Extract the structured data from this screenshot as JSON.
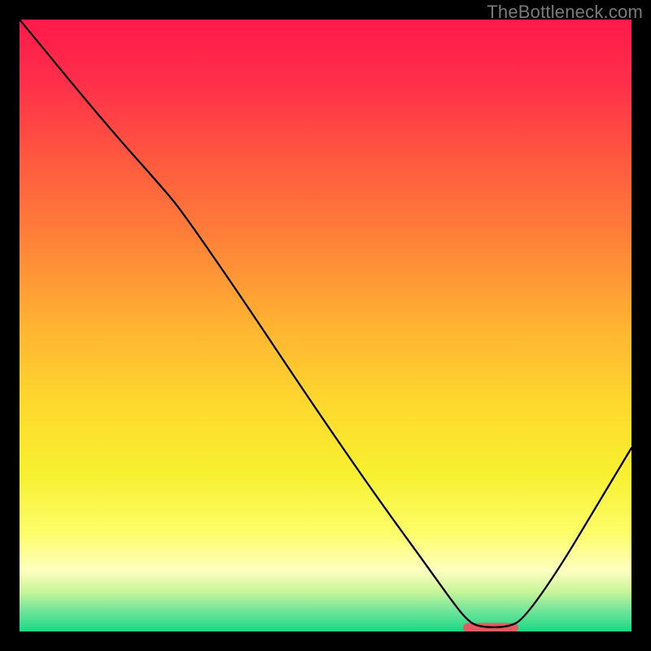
{
  "watermark": "TheBottleneck.com",
  "chart_data": {
    "type": "line",
    "title": "",
    "xlabel": "",
    "ylabel": "",
    "xlim": [
      0,
      100
    ],
    "ylim": [
      0,
      100
    ],
    "background_gradient_stops": [
      {
        "offset": 0.0,
        "color": "#ff1a4b"
      },
      {
        "offset": 0.1,
        "color": "#ff2e4a"
      },
      {
        "offset": 0.22,
        "color": "#ff5640"
      },
      {
        "offset": 0.35,
        "color": "#ff7e39"
      },
      {
        "offset": 0.5,
        "color": "#ffb332"
      },
      {
        "offset": 0.63,
        "color": "#ffd92e"
      },
      {
        "offset": 0.74,
        "color": "#f7f02f"
      },
      {
        "offset": 0.84,
        "color": "#fdfd6a"
      },
      {
        "offset": 0.9,
        "color": "#ffffc0"
      },
      {
        "offset": 0.935,
        "color": "#c8f59a"
      },
      {
        "offset": 0.965,
        "color": "#74e59b"
      },
      {
        "offset": 1.0,
        "color": "#19d885"
      }
    ],
    "curve_points": [
      {
        "x": 0.0,
        "y": 100.0
      },
      {
        "x": 14.0,
        "y": 83.0
      },
      {
        "x": 24.0,
        "y": 71.8
      },
      {
        "x": 27.0,
        "y": 68.0
      },
      {
        "x": 36.0,
        "y": 55.0
      },
      {
        "x": 48.0,
        "y": 37.0
      },
      {
        "x": 58.0,
        "y": 22.5
      },
      {
        "x": 66.0,
        "y": 11.5
      },
      {
        "x": 70.5,
        "y": 5.2
      },
      {
        "x": 73.0,
        "y": 2.0
      },
      {
        "x": 75.0,
        "y": 0.7
      },
      {
        "x": 80.0,
        "y": 0.7
      },
      {
        "x": 82.5,
        "y": 2.2
      },
      {
        "x": 88.0,
        "y": 10.0
      },
      {
        "x": 94.0,
        "y": 20.0
      },
      {
        "x": 100.0,
        "y": 30.0
      }
    ],
    "marker": {
      "x_center": 77.0,
      "y": 0.6,
      "width": 9.0,
      "height": 1.6,
      "color": "#e25a62"
    }
  }
}
